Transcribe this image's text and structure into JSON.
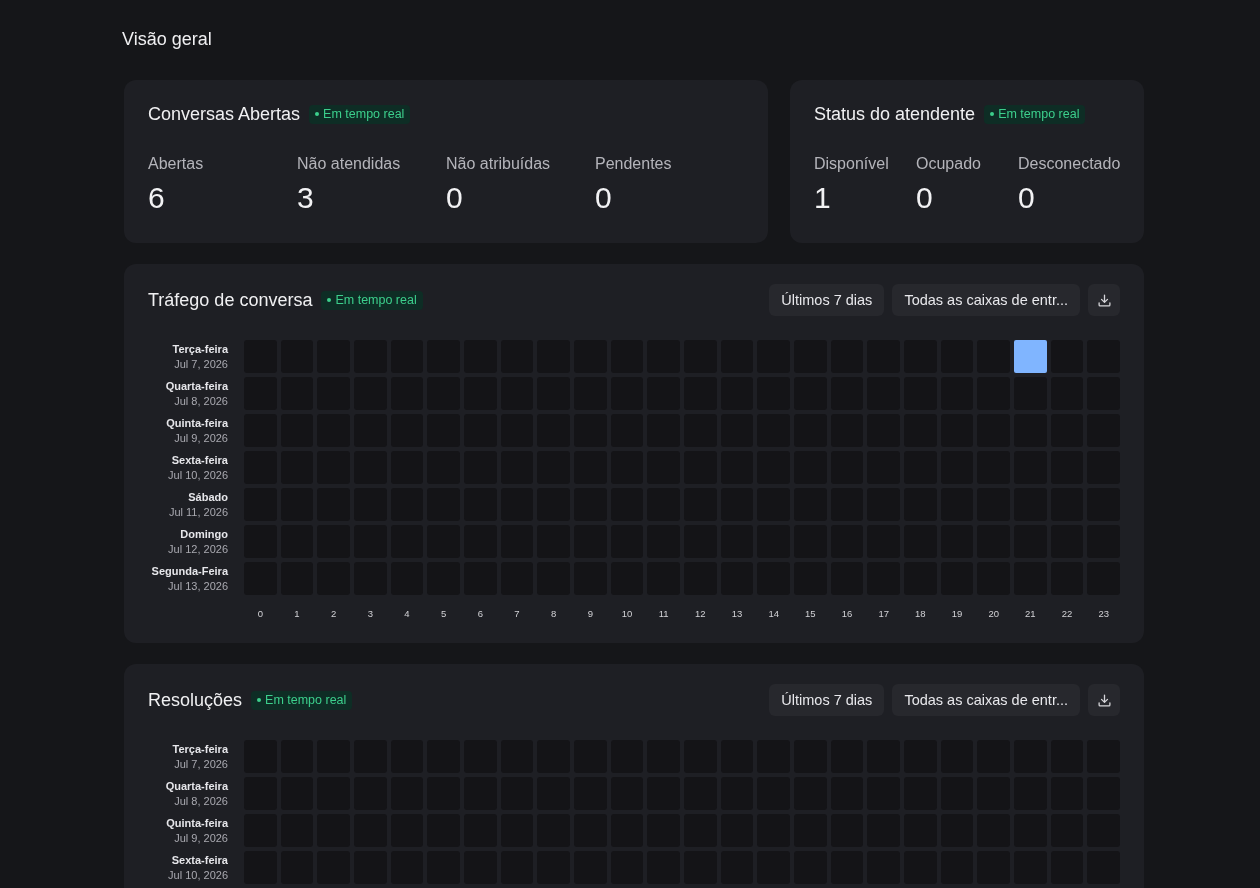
{
  "page": {
    "title": "Visão geral"
  },
  "open_conversations": {
    "title": "Conversas Abertas",
    "badge": "Em tempo real",
    "metrics": [
      {
        "label": "Abertas",
        "value": "6"
      },
      {
        "label": "Não atendidas",
        "value": "3"
      },
      {
        "label": "Não atribuídas",
        "value": "0"
      },
      {
        "label": "Pendentes",
        "value": "0"
      }
    ]
  },
  "agent_status": {
    "title": "Status do atendente",
    "badge": "Em tempo real",
    "metrics": [
      {
        "label": "Disponível",
        "value": "1"
      },
      {
        "label": "Ocupado",
        "value": "0"
      },
      {
        "label": "Desconectado",
        "value": "0"
      }
    ]
  },
  "heatmaps": [
    {
      "title": "Tráfego de conversa",
      "badge": "Em tempo real",
      "range": "Últimos 7 dias",
      "inbox": "Todas as caixas de entr...",
      "rows": [
        {
          "weekday": "Terça-feira",
          "date": "Jul 7, 2026",
          "cells": [
            {
              "active": false
            },
            {
              "active": false
            },
            {
              "active": false
            },
            {
              "active": false
            },
            {
              "active": false
            },
            {
              "active": false
            },
            {
              "active": false
            },
            {
              "active": false
            },
            {
              "active": false
            },
            {
              "active": false
            },
            {
              "active": false
            },
            {
              "active": false
            },
            {
              "active": false
            },
            {
              "active": false
            },
            {
              "active": false
            },
            {
              "active": false
            },
            {
              "active": false
            },
            {
              "active": false
            },
            {
              "active": false
            },
            {
              "active": false
            },
            {
              "active": false
            },
            {
              "active": true
            },
            {
              "active": false
            },
            {
              "active": false
            }
          ]
        },
        {
          "weekday": "Quarta-feira",
          "date": "Jul 8, 2026",
          "cells": [
            {
              "active": false
            },
            {
              "active": false
            },
            {
              "active": false
            },
            {
              "active": false
            },
            {
              "active": false
            },
            {
              "active": false
            },
            {
              "active": false
            },
            {
              "active": false
            },
            {
              "active": false
            },
            {
              "active": false
            },
            {
              "active": false
            },
            {
              "active": false
            },
            {
              "active": false
            },
            {
              "active": false
            },
            {
              "active": false
            },
            {
              "active": false
            },
            {
              "active": false
            },
            {
              "active": false
            },
            {
              "active": false
            },
            {
              "active": false
            },
            {
              "active": false
            },
            {
              "active": false
            },
            {
              "active": false
            },
            {
              "active": false
            }
          ]
        },
        {
          "weekday": "Quinta-feira",
          "date": "Jul 9, 2026",
          "cells": [
            {
              "active": false
            },
            {
              "active": false
            },
            {
              "active": false
            },
            {
              "active": false
            },
            {
              "active": false
            },
            {
              "active": false
            },
            {
              "active": false
            },
            {
              "active": false
            },
            {
              "active": false
            },
            {
              "active": false
            },
            {
              "active": false
            },
            {
              "active": false
            },
            {
              "active": false
            },
            {
              "active": false
            },
            {
              "active": false
            },
            {
              "active": false
            },
            {
              "active": false
            },
            {
              "active": false
            },
            {
              "active": false
            },
            {
              "active": false
            },
            {
              "active": false
            },
            {
              "active": false
            },
            {
              "active": false
            },
            {
              "active": false
            }
          ]
        },
        {
          "weekday": "Sexta-feira",
          "date": "Jul 10, 2026",
          "cells": [
            {
              "active": false
            },
            {
              "active": false
            },
            {
              "active": false
            },
            {
              "active": false
            },
            {
              "active": false
            },
            {
              "active": false
            },
            {
              "active": false
            },
            {
              "active": false
            },
            {
              "active": false
            },
            {
              "active": false
            },
            {
              "active": false
            },
            {
              "active": false
            },
            {
              "active": false
            },
            {
              "active": false
            },
            {
              "active": false
            },
            {
              "active": false
            },
            {
              "active": false
            },
            {
              "active": false
            },
            {
              "active": false
            },
            {
              "active": false
            },
            {
              "active": false
            },
            {
              "active": false
            },
            {
              "active": false
            },
            {
              "active": false
            }
          ]
        },
        {
          "weekday": "Sábado",
          "date": "Jul 11, 2026",
          "cells": [
            {
              "active": false
            },
            {
              "active": false
            },
            {
              "active": false
            },
            {
              "active": false
            },
            {
              "active": false
            },
            {
              "active": false
            },
            {
              "active": false
            },
            {
              "active": false
            },
            {
              "active": false
            },
            {
              "active": false
            },
            {
              "active": false
            },
            {
              "active": false
            },
            {
              "active": false
            },
            {
              "active": false
            },
            {
              "active": false
            },
            {
              "active": false
            },
            {
              "active": false
            },
            {
              "active": false
            },
            {
              "active": false
            },
            {
              "active": false
            },
            {
              "active": false
            },
            {
              "active": false
            },
            {
              "active": false
            },
            {
              "active": false
            }
          ]
        },
        {
          "weekday": "Domingo",
          "date": "Jul 12, 2026",
          "cells": [
            {
              "active": false
            },
            {
              "active": false
            },
            {
              "active": false
            },
            {
              "active": false
            },
            {
              "active": false
            },
            {
              "active": false
            },
            {
              "active": false
            },
            {
              "active": false
            },
            {
              "active": false
            },
            {
              "active": false
            },
            {
              "active": false
            },
            {
              "active": false
            },
            {
              "active": false
            },
            {
              "active": false
            },
            {
              "active": false
            },
            {
              "active": false
            },
            {
              "active": false
            },
            {
              "active": false
            },
            {
              "active": false
            },
            {
              "active": false
            },
            {
              "active": false
            },
            {
              "active": false
            },
            {
              "active": false
            },
            {
              "active": false
            }
          ]
        },
        {
          "weekday": "Segunda-Feira",
          "date": "Jul 13, 2026",
          "cells": [
            {
              "active": false
            },
            {
              "active": false
            },
            {
              "active": false
            },
            {
              "active": false
            },
            {
              "active": false
            },
            {
              "active": false
            },
            {
              "active": false
            },
            {
              "active": false
            },
            {
              "active": false
            },
            {
              "active": false
            },
            {
              "active": false
            },
            {
              "active": false
            },
            {
              "active": false
            },
            {
              "active": false
            },
            {
              "active": false
            },
            {
              "active": false
            },
            {
              "active": false
            },
            {
              "active": false
            },
            {
              "active": false
            },
            {
              "active": false
            },
            {
              "active": false
            },
            {
              "active": false
            },
            {
              "active": false
            },
            {
              "active": false
            }
          ]
        }
      ],
      "hours": [
        "0",
        "1",
        "2",
        "3",
        "4",
        "5",
        "6",
        "7",
        "8",
        "9",
        "10",
        "11",
        "12",
        "13",
        "14",
        "15",
        "16",
        "17",
        "18",
        "19",
        "20",
        "21",
        "22",
        "23"
      ]
    },
    {
      "title": "Resoluções",
      "badge": "Em tempo real",
      "range": "Últimos 7 dias",
      "inbox": "Todas as caixas de entr...",
      "rows": [
        {
          "weekday": "Terça-feira",
          "date": "Jul 7, 2026",
          "cells": [
            {
              "active": false
            },
            {
              "active": false
            },
            {
              "active": false
            },
            {
              "active": false
            },
            {
              "active": false
            },
            {
              "active": false
            },
            {
              "active": false
            },
            {
              "active": false
            },
            {
              "active": false
            },
            {
              "active": false
            },
            {
              "active": false
            },
            {
              "active": false
            },
            {
              "active": false
            },
            {
              "active": false
            },
            {
              "active": false
            },
            {
              "active": false
            },
            {
              "active": false
            },
            {
              "active": false
            },
            {
              "active": false
            },
            {
              "active": false
            },
            {
              "active": false
            },
            {
              "active": false
            },
            {
              "active": false
            },
            {
              "active": false
            }
          ]
        },
        {
          "weekday": "Quarta-feira",
          "date": "Jul 8, 2026",
          "cells": [
            {
              "active": false
            },
            {
              "active": false
            },
            {
              "active": false
            },
            {
              "active": false
            },
            {
              "active": false
            },
            {
              "active": false
            },
            {
              "active": false
            },
            {
              "active": false
            },
            {
              "active": false
            },
            {
              "active": false
            },
            {
              "active": false
            },
            {
              "active": false
            },
            {
              "active": false
            },
            {
              "active": false
            },
            {
              "active": false
            },
            {
              "active": false
            },
            {
              "active": false
            },
            {
              "active": false
            },
            {
              "active": false
            },
            {
              "active": false
            },
            {
              "active": false
            },
            {
              "active": false
            },
            {
              "active": false
            },
            {
              "active": false
            }
          ]
        },
        {
          "weekday": "Quinta-feira",
          "date": "Jul 9, 2026",
          "cells": [
            {
              "active": false
            },
            {
              "active": false
            },
            {
              "active": false
            },
            {
              "active": false
            },
            {
              "active": false
            },
            {
              "active": false
            },
            {
              "active": false
            },
            {
              "active": false
            },
            {
              "active": false
            },
            {
              "active": false
            },
            {
              "active": false
            },
            {
              "active": false
            },
            {
              "active": false
            },
            {
              "active": false
            },
            {
              "active": false
            },
            {
              "active": false
            },
            {
              "active": false
            },
            {
              "active": false
            },
            {
              "active": false
            },
            {
              "active": false
            },
            {
              "active": false
            },
            {
              "active": false
            },
            {
              "active": false
            },
            {
              "active": false
            }
          ]
        },
        {
          "weekday": "Sexta-feira",
          "date": "Jul 10, 2026",
          "cells": [
            {
              "active": false
            },
            {
              "active": false
            },
            {
              "active": false
            },
            {
              "active": false
            },
            {
              "active": false
            },
            {
              "active": false
            },
            {
              "active": false
            },
            {
              "active": false
            },
            {
              "active": false
            },
            {
              "active": false
            },
            {
              "active": false
            },
            {
              "active": false
            },
            {
              "active": false
            },
            {
              "active": false
            },
            {
              "active": false
            },
            {
              "active": false
            },
            {
              "active": false
            },
            {
              "active": false
            },
            {
              "active": false
            },
            {
              "active": false
            },
            {
              "active": false
            },
            {
              "active": false
            },
            {
              "active": false
            },
            {
              "active": false
            }
          ]
        }
      ]
    }
  ]
}
